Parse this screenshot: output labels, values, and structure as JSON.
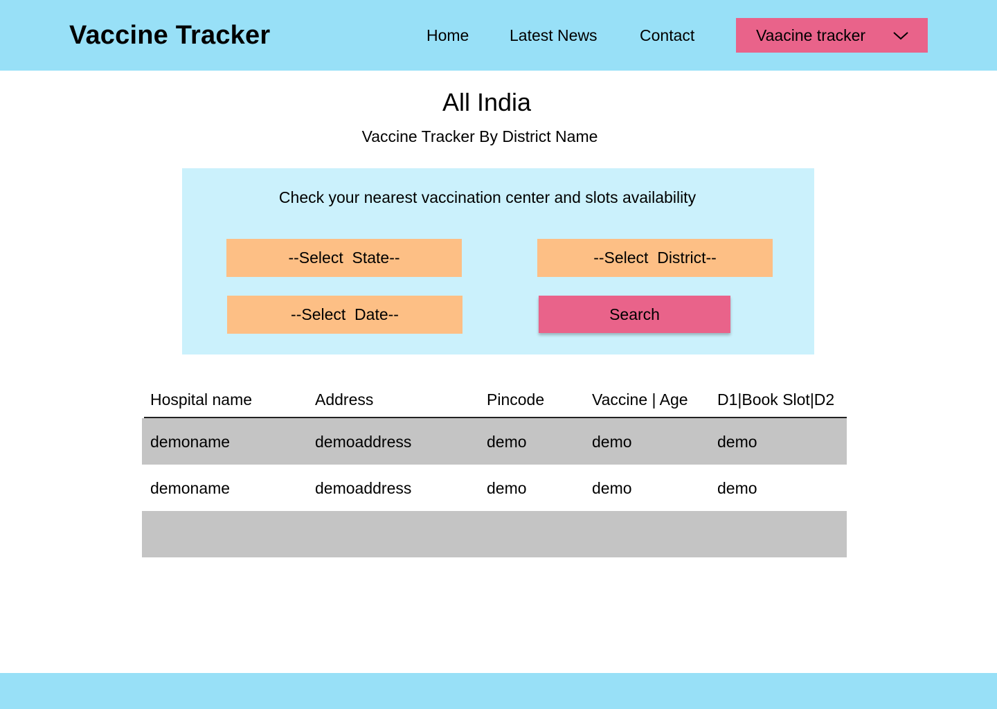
{
  "header": {
    "brand": "Vaccine Tracker",
    "nav": {
      "home": "Home",
      "news": "Latest News",
      "contact": "Contact"
    },
    "dropdown_label": "Vaacine tracker",
    "dropdown_icon": "chevron-down-icon"
  },
  "main": {
    "title": "All India",
    "subtitle": "Vaccine Tracker By District Name"
  },
  "search_panel": {
    "heading": "Check your nearest vaccination center and slots availability",
    "state_select": "--Select  State--",
    "district_select": "--Select  District--",
    "date_select": "--Select  Date--",
    "search_label": "Search"
  },
  "table": {
    "headers": [
      "Hospital name",
      "Address",
      "Pincode",
      "Vaccine | Age",
      "D1|Book Slot|D2"
    ],
    "rows": [
      [
        "demoname",
        "demoaddress",
        "demo",
        "demo",
        "demo"
      ],
      [
        "demoname",
        "demoaddress",
        "demo",
        "demo",
        "demo"
      ],
      [
        "",
        "",
        "",
        "",
        ""
      ]
    ]
  },
  "colors": {
    "header_bg": "#98e0f7",
    "panel_bg": "#cbf1fc",
    "accent_pink": "#e9638a",
    "select_orange": "#fdbf85",
    "row_shade": "#c4c4c4"
  }
}
